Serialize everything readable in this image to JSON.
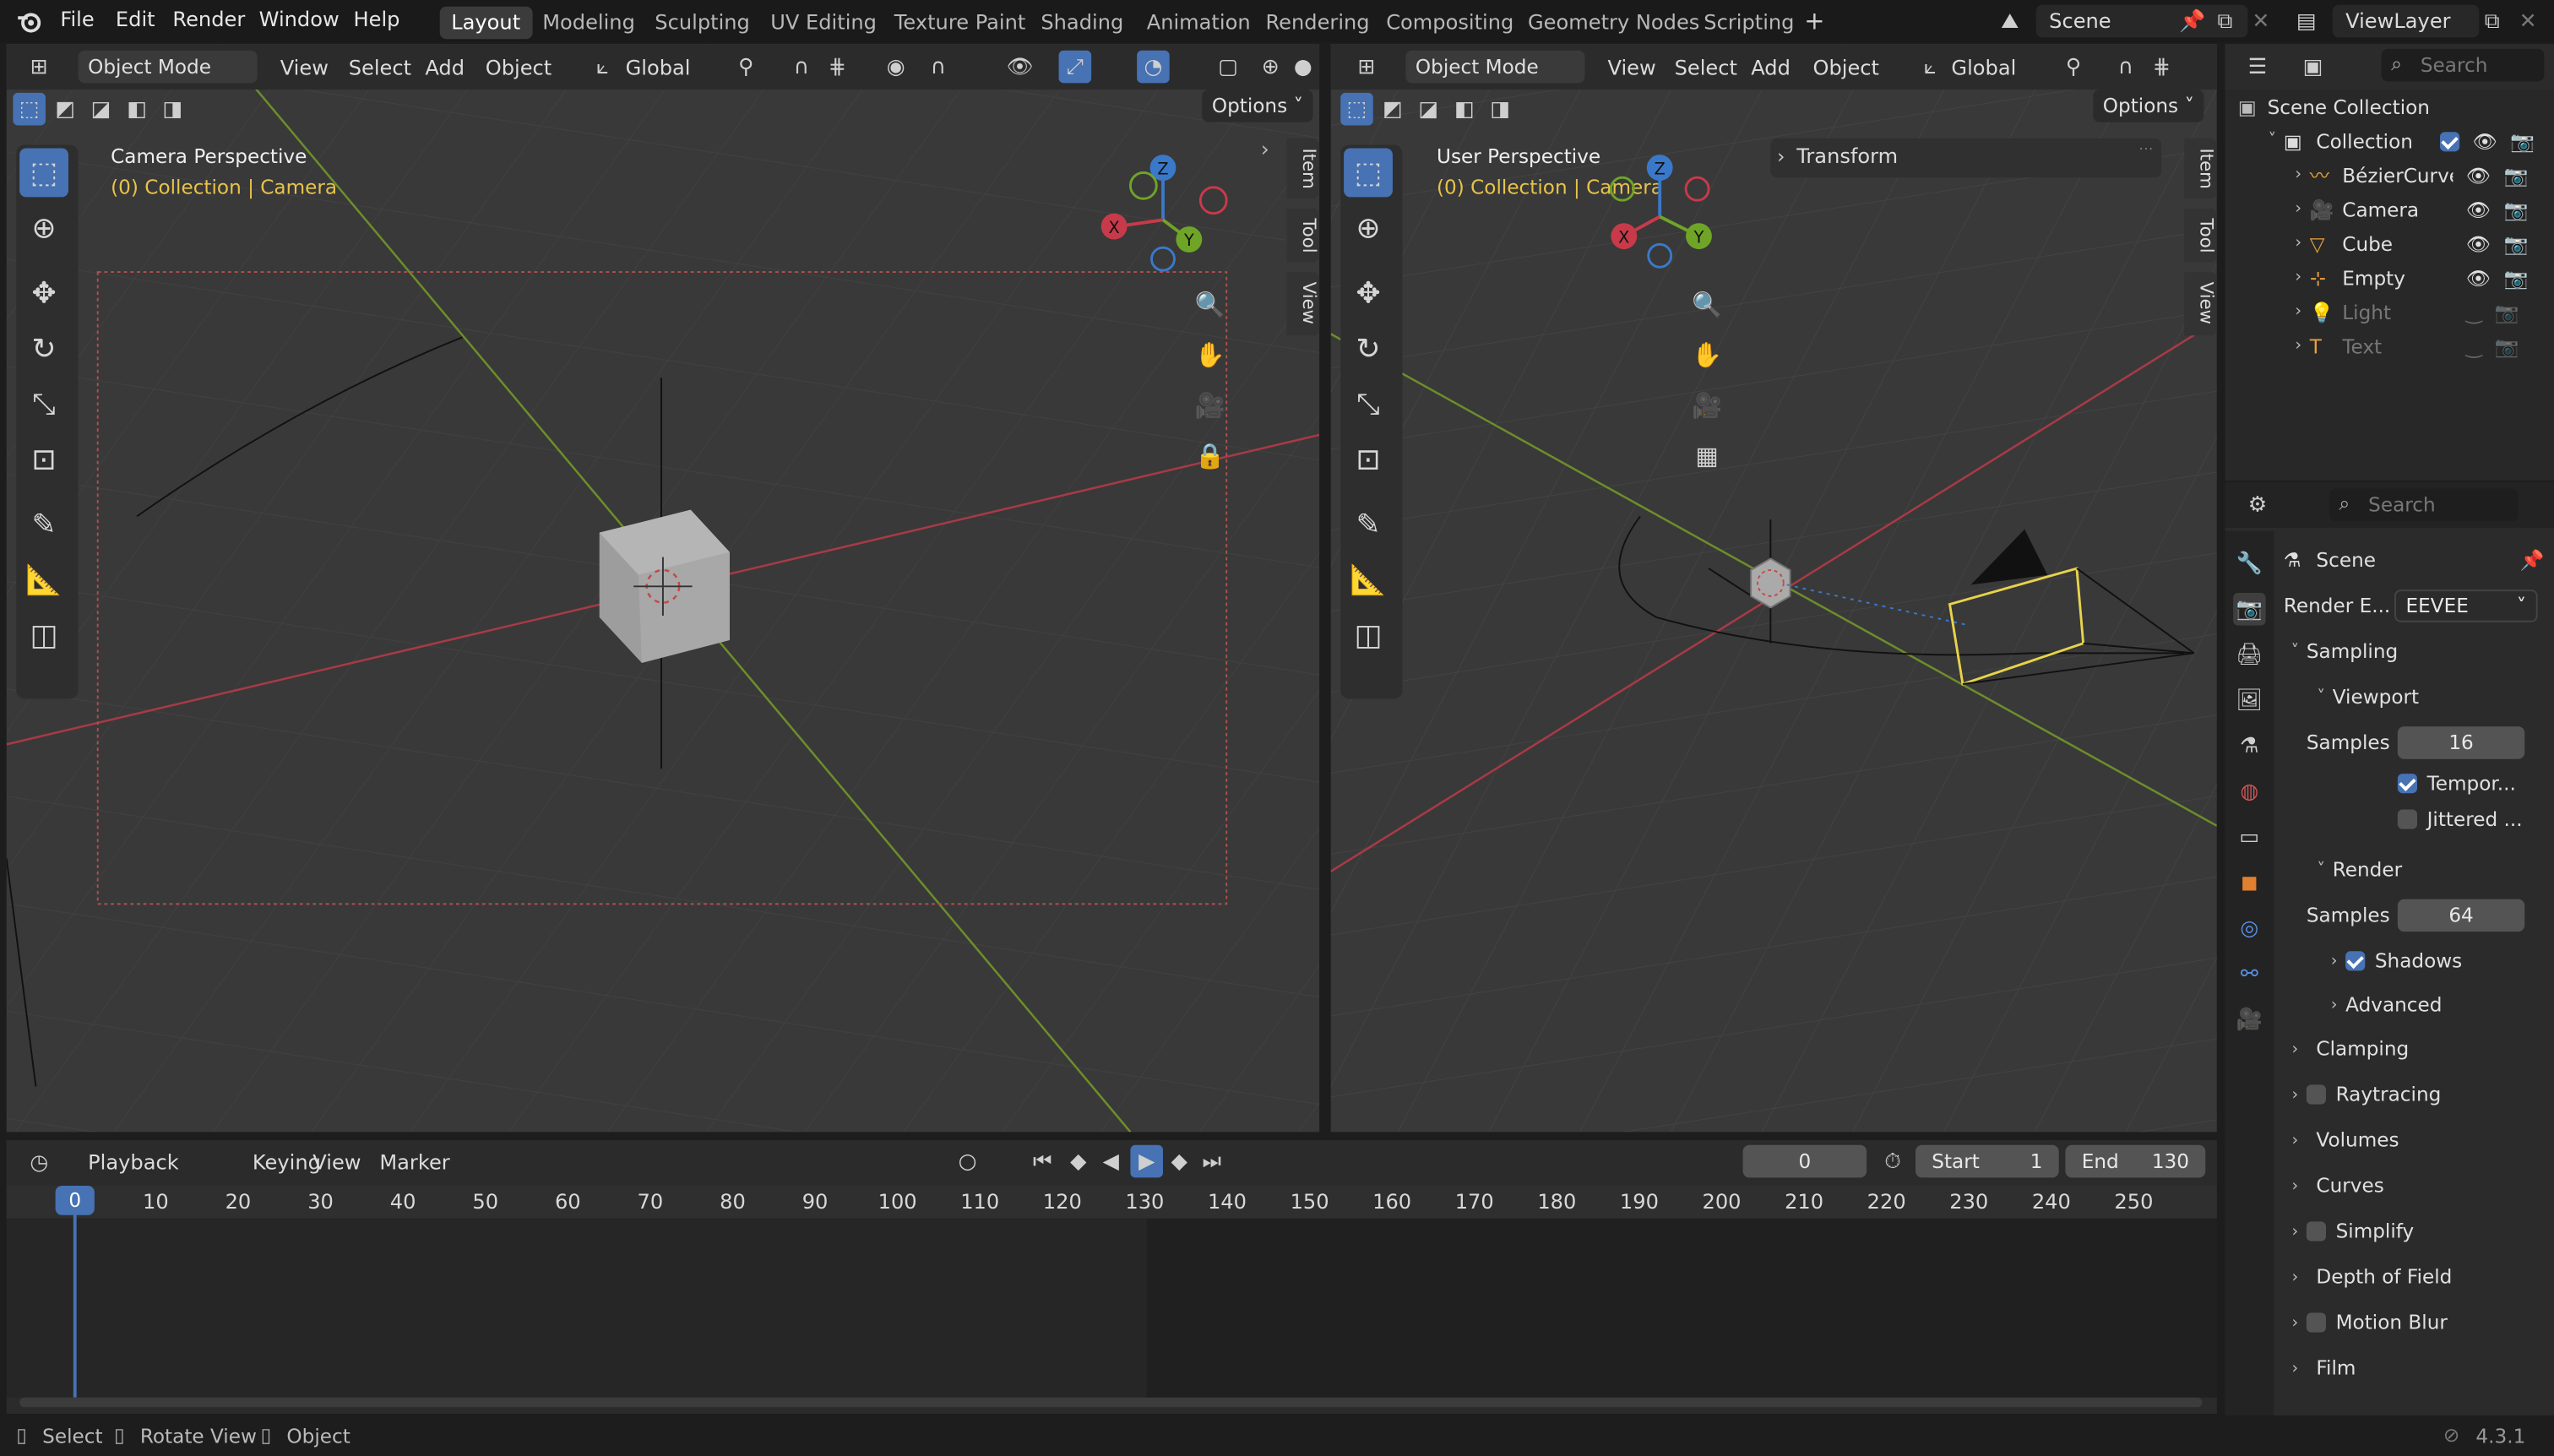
{
  "topmenu": {
    "items": [
      "File",
      "Edit",
      "Render",
      "Window",
      "Help"
    ]
  },
  "workspaces": {
    "tabs": [
      "Layout",
      "Modeling",
      "Sculpting",
      "UV Editing",
      "Texture Paint",
      "Shading",
      "Animation",
      "Rendering",
      "Compositing",
      "Geometry Nodes",
      "Scripting"
    ],
    "active": "Layout"
  },
  "scene": {
    "name": "Scene"
  },
  "viewlayer": {
    "name": "ViewLayer"
  },
  "viewport_left": {
    "mode": "Object Mode",
    "menus": [
      "View",
      "Select",
      "Add",
      "Object"
    ],
    "orientation": "Global",
    "options": "Options",
    "title": "Camera Perspective",
    "subtitle": "(0) Collection | Camera",
    "sidetabs": [
      "Item",
      "Tool",
      "View"
    ]
  },
  "viewport_right": {
    "mode": "Object Mode",
    "menus": [
      "View",
      "Select",
      "Add",
      "Object"
    ],
    "orientation": "Global",
    "options": "Options",
    "title": "User Perspective",
    "subtitle": "(0) Collection | Camera",
    "panel": "Transform",
    "sidetabs": [
      "Item",
      "Tool",
      "View"
    ]
  },
  "gizmo": {
    "x": "X",
    "y": "Y",
    "z": "Z"
  },
  "outliner": {
    "search_placeholder": "Search",
    "scene_collection": "Scene Collection",
    "collection": "Collection",
    "items": [
      {
        "name": "BézierCurve",
        "visible": true
      },
      {
        "name": "Camera",
        "visible": true
      },
      {
        "name": "Cube",
        "visible": true
      },
      {
        "name": "Empty",
        "visible": true
      },
      {
        "name": "Light",
        "visible": false
      },
      {
        "name": "Text",
        "visible": false
      }
    ]
  },
  "properties": {
    "search_placeholder": "Search",
    "title": "Scene",
    "render_engine_label": "Render E...",
    "render_engine": "EEVEE",
    "sampling": "Sampling",
    "viewport": "Viewport",
    "samples_label": "Samples",
    "viewport_samples": "16",
    "temporal": "Tempor...",
    "jittered": "Jittered ...",
    "render": "Render",
    "render_samples": "64",
    "shadows": "Shadows",
    "advanced": "Advanced",
    "sections": [
      "Clamping",
      "Raytracing",
      "Volumes",
      "Curves",
      "Simplify",
      "Depth of Field",
      "Motion Blur",
      "Film"
    ]
  },
  "timeline": {
    "menus": [
      "Playback",
      "Keying",
      "View",
      "Marker"
    ],
    "current_frame": "0",
    "start_label": "Start",
    "start": "1",
    "end_label": "End",
    "end": "130",
    "ticks": [
      "0",
      "10",
      "20",
      "30",
      "40",
      "50",
      "60",
      "70",
      "80",
      "90",
      "100",
      "110",
      "120",
      "130",
      "140",
      "150",
      "160",
      "170",
      "180",
      "190",
      "200",
      "210",
      "220",
      "230",
      "240",
      "250"
    ]
  },
  "statusbar": {
    "items": [
      "Select",
      "Rotate View",
      "Object"
    ],
    "version": "4.3.1"
  }
}
